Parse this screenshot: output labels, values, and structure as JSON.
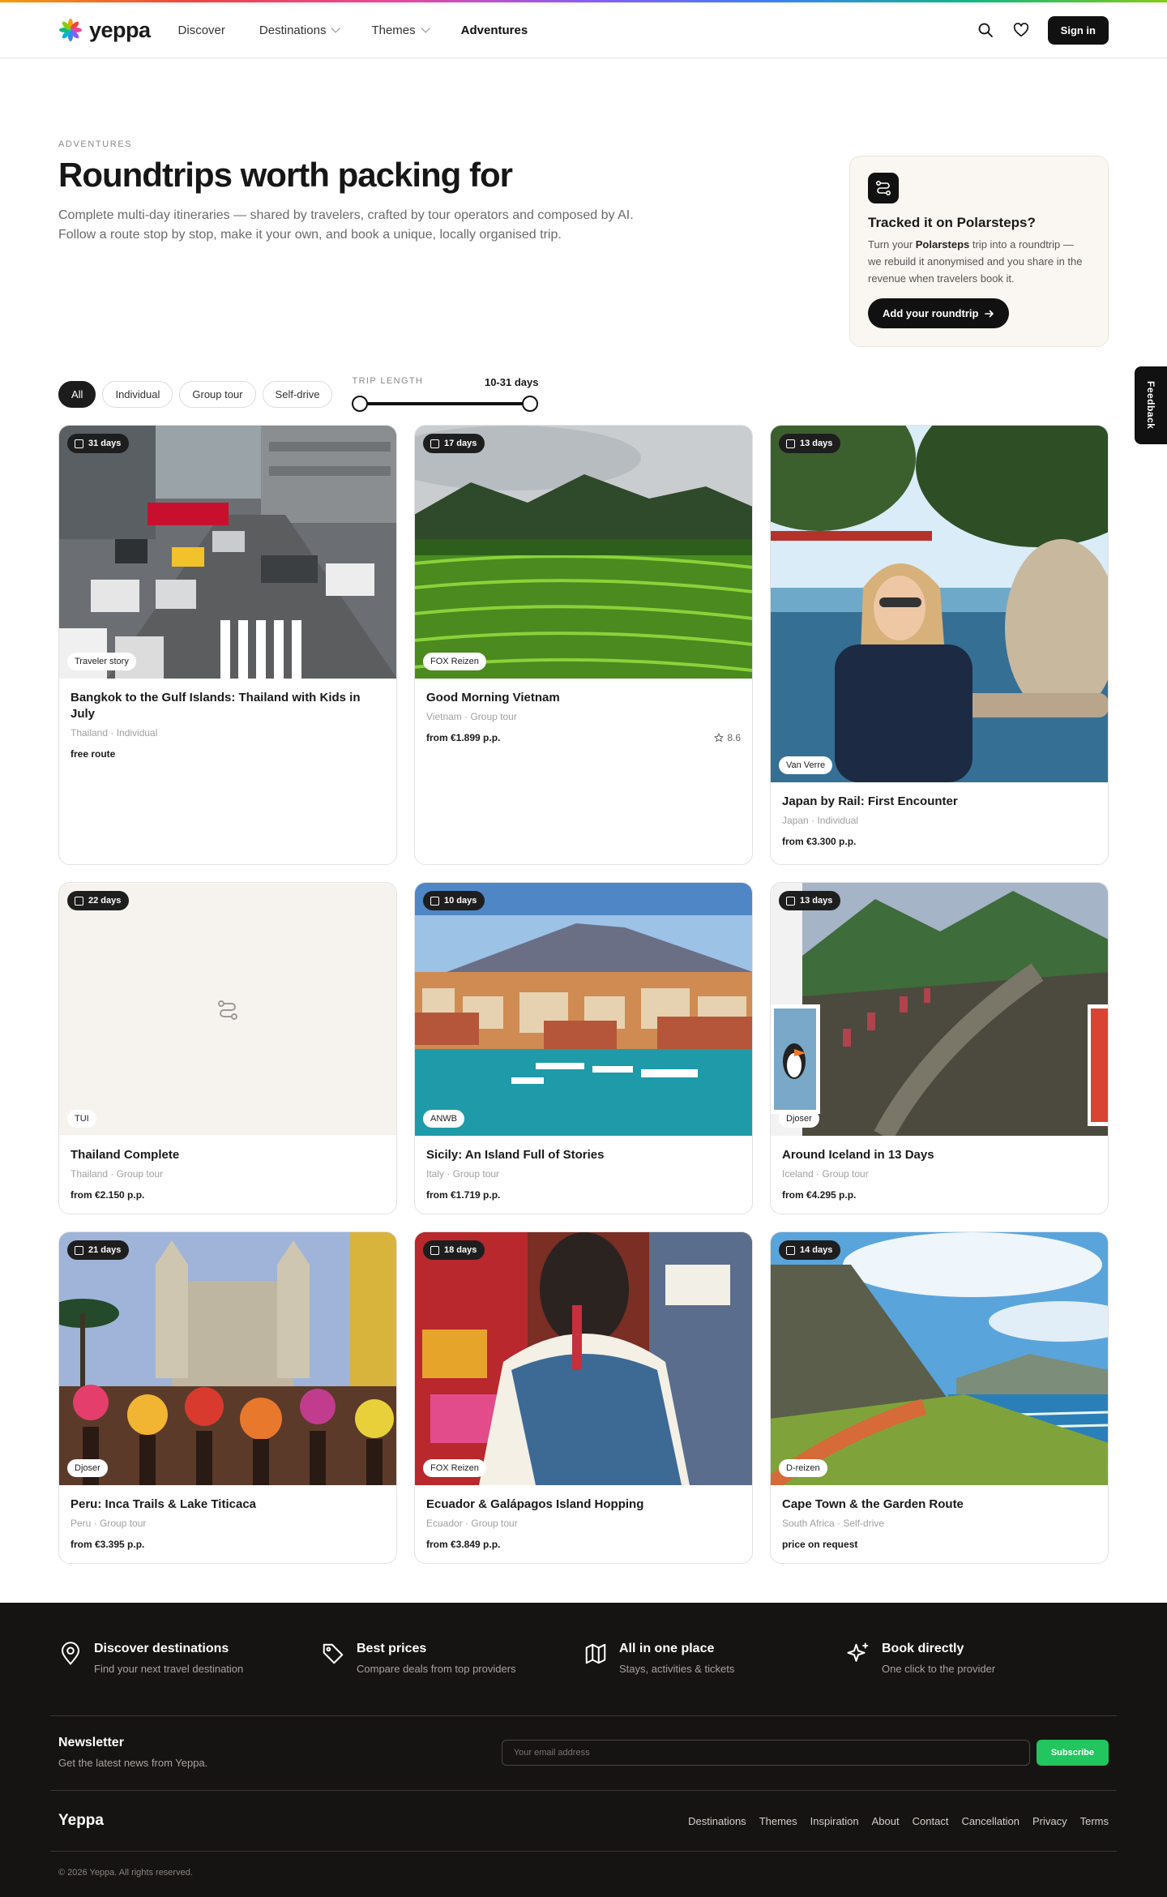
{
  "header": {
    "logo": "yeppa",
    "nav": [
      {
        "label": "Discover",
        "dropdown": false,
        "active": false
      },
      {
        "label": "Destinations",
        "dropdown": true,
        "active": false
      },
      {
        "label": "Themes",
        "dropdown": true,
        "active": false
      },
      {
        "label": "Adventures",
        "dropdown": false,
        "active": true
      }
    ],
    "sign_in": "Sign in"
  },
  "hero": {
    "eyebrow": "ADVENTURES",
    "title": "Roundtrips worth packing for",
    "subtitle_line1": "Complete multi-day itineraries — shared by travelers, crafted by tour operators and composed by AI.",
    "subtitle_line2": "Follow a route stop by stop, make it your own, and book a unique, locally organised trip."
  },
  "promo": {
    "title": "Tracked it on Polarsteps?",
    "text_before": "Turn your ",
    "text_bold": "Polarsteps",
    "text_after": " trip into a roundtrip — we rebuild it anonymised and you share in the revenue when travelers book it.",
    "button": "Add your roundtrip"
  },
  "filters": {
    "chips": [
      "All",
      "Individual",
      "Group tour",
      "Self-drive"
    ],
    "active_chip": "All",
    "trip_length_label": "TRIP LENGTH",
    "trip_length_value": "10-31 days"
  },
  "cards": [
    {
      "days": "31 days",
      "provider": "Traveler story",
      "title": "Bangkok to the Gulf Islands: Thailand with Kids in July",
      "meta": "Thailand · Individual",
      "price": "free route",
      "rating": "",
      "scene": "city"
    },
    {
      "days": "17 days",
      "provider": "FOX Reizen",
      "title": "Good Morning Vietnam",
      "meta": "Vietnam · Group tour",
      "price": "from €1.899 p.p.",
      "rating": "8.6",
      "scene": "rice"
    },
    {
      "days": "13 days",
      "provider": "Van Verre",
      "title": "Japan by Rail: First Encounter",
      "meta": "Japan · Individual",
      "price": "from €3.300 p.p.",
      "rating": "",
      "scene": "japan"
    },
    {
      "days": "22 days",
      "provider": "TUI",
      "title": "Thailand Complete",
      "meta": "Thailand · Group tour",
      "price": "from €2.150 p.p.",
      "rating": "",
      "scene": "placeholder"
    },
    {
      "days": "10 days",
      "provider": "ANWB",
      "title": "Sicily: An Island Full of Stories",
      "meta": "Italy · Group tour",
      "price": "from €1.719 p.p.",
      "rating": "",
      "scene": "sicily"
    },
    {
      "days": "13 days",
      "provider": "Djoser",
      "title": "Around Iceland in 13 Days",
      "meta": "Iceland · Group tour",
      "price": "from €4.295 p.p.",
      "rating": "",
      "scene": "iceland"
    },
    {
      "days": "21 days",
      "provider": "Djoser",
      "title": "Peru: Inca Trails & Lake Titicaca",
      "meta": "Peru · Group tour",
      "price": "from €3.395 p.p.",
      "rating": "",
      "scene": "peru"
    },
    {
      "days": "18 days",
      "provider": "FOX Reizen",
      "title": "Ecuador & Galápagos Island Hopping",
      "meta": "Ecuador · Group tour",
      "price": "from €3.849 p.p.",
      "rating": "",
      "scene": "ecuador"
    },
    {
      "days": "14 days",
      "provider": "D-reizen",
      "title": "Cape Town & the Garden Route",
      "meta": "South Africa · Self-drive",
      "price": "price on request",
      "rating": "",
      "scene": "cape"
    }
  ],
  "feedback": "Feedback",
  "footer": {
    "features": [
      {
        "icon": "map-pin-icon",
        "title": "Discover destinations",
        "sub": "Find your next travel destination"
      },
      {
        "icon": "tag-icon",
        "title": "Best prices",
        "sub": "Compare deals from top providers"
      },
      {
        "icon": "map-icon",
        "title": "All in one place",
        "sub": "Stays, activities & tickets"
      },
      {
        "icon": "sparkle-icon",
        "title": "Book directly",
        "sub": "One click to the provider"
      }
    ],
    "newsletter_title": "Newsletter",
    "newsletter_sub": "Get the latest news from Yeppa.",
    "email_placeholder": "Your email address",
    "subscribe": "Subscribe",
    "logo": "Yeppa",
    "links": [
      "Destinations",
      "Themes",
      "Inspiration",
      "About",
      "Contact",
      "Cancellation",
      "Privacy",
      "Terms"
    ],
    "copyright": "© 2026 Yeppa. All rights reserved."
  }
}
